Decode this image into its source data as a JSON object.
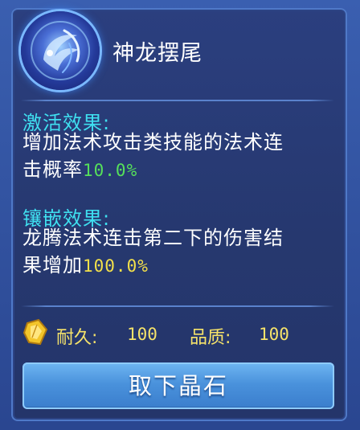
{
  "item": {
    "name": "神龙摆尾",
    "icon": "dragon-tail-skill-icon"
  },
  "activation": {
    "heading": "激活效果:",
    "text_line1": "增加法术攻击类技能的法术连",
    "text_line2_prefix": "击概率",
    "value": "10.0%"
  },
  "inlay": {
    "heading": "镶嵌效果:",
    "text_line1": "龙腾法术连击第二下的伤害结",
    "text_line2_prefix": "果增加",
    "value": "100.0%"
  },
  "stats": {
    "durability_label": "耐久:",
    "durability_value": "100",
    "quality_label": "品质:",
    "quality_value": "100"
  },
  "actions": {
    "remove_label": "取下晶石"
  },
  "colors": {
    "heading": "#3fe0f0",
    "green_value": "#56e05a",
    "yellow_value": "#f3e04a",
    "button": "#4a92dc"
  }
}
